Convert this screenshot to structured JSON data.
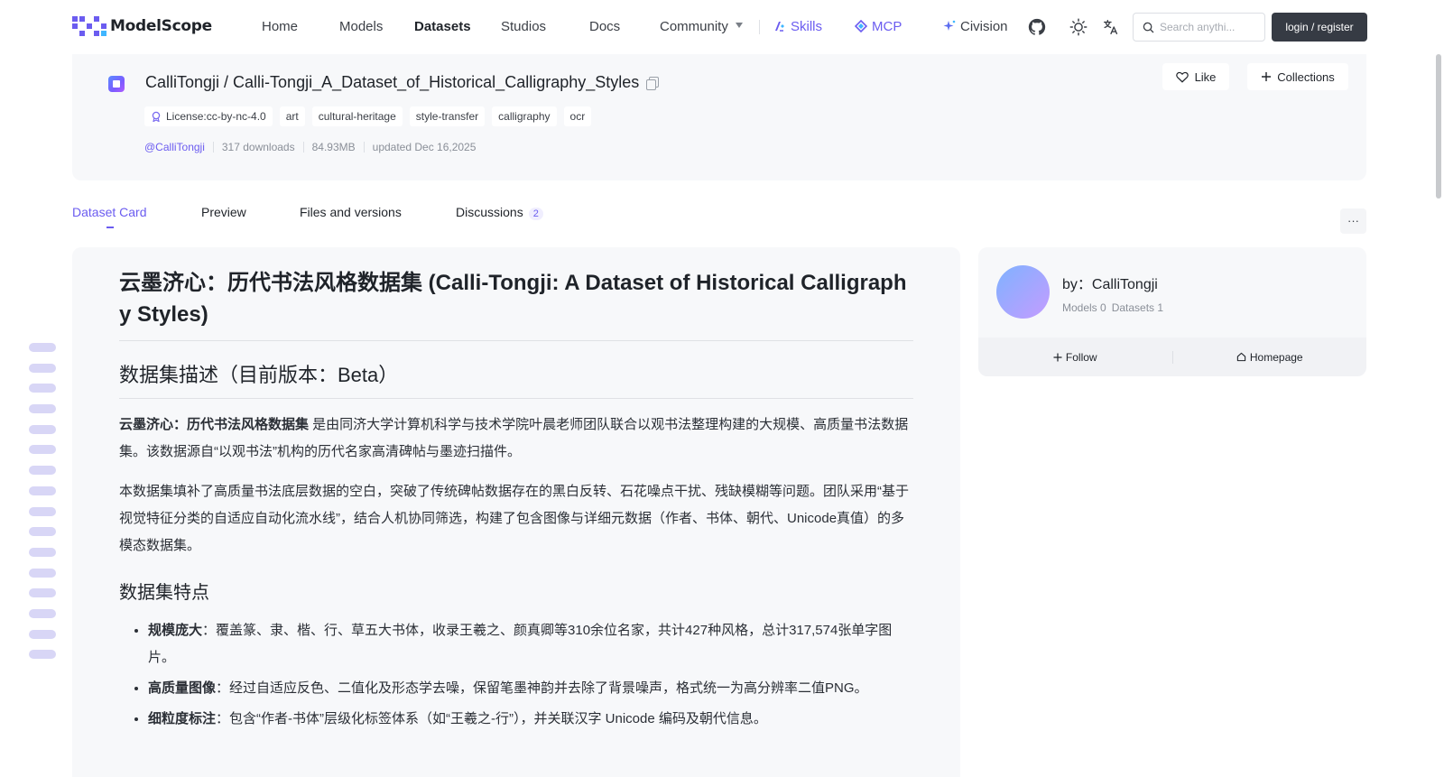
{
  "brand": {
    "name": "ModelScope"
  },
  "nav": {
    "home": "Home",
    "models": "Models",
    "datasets": "Datasets",
    "studios": "Studios",
    "docs": "Docs",
    "community": "Community",
    "skills": "Skills",
    "mcp": "MCP",
    "civision": "Civision"
  },
  "search": {
    "placeholder": "Search anythi..."
  },
  "auth": {
    "login_label": "login / register"
  },
  "dataset": {
    "title": "CalliTongji / Calli-Tongji_A_Dataset_of_Historical_Calligraphy_Styles",
    "license": "License:cc-by-nc-4.0",
    "tags": [
      "art",
      "cultural-heritage",
      "style-transfer",
      "calligraphy",
      "ocr"
    ],
    "owner": "@CalliTongji",
    "downloads": "317 downloads",
    "size": "84.93MB",
    "updated": "updated Dec 16,2025",
    "like_label": "Like",
    "collections_label": "Collections"
  },
  "tabs": {
    "card": "Dataset Card",
    "preview": "Preview",
    "files": "Files and versions",
    "discussions": "Discussions",
    "discussions_count": "2",
    "more": "···"
  },
  "card": {
    "h1": "云墨济心：历代书法风格数据集 (Calli-Tongji: A Dataset of Historical Calligraphy Styles)",
    "h2": "数据集描述（目前版本：Beta）",
    "p1_bold": "云墨济心：历代书法风格数据集",
    "p1_rest": " 是由同济大学计算机科学与技术学院叶晨老师团队联合以观书法整理构建的大规模、高质量书法数据集。该数据源自“以观书法”机构的历代名家高清碑帖与墨迹扫描件。",
    "p2": "本数据集填补了高质量书法底层数据的空白，突破了传统碑帖数据存在的黑白反转、石花噪点干扰、残缺模糊等问题。团队采用“基于视觉特征分类的自适应自动化流水线”，结合人机协同筛选，构建了包含图像与详细元数据（作者、书体、朝代、Unicode真值）的多模态数据集。",
    "h3": "数据集特点",
    "features": [
      {
        "title": "规模庞大",
        "text": "：覆盖篆、隶、楷、行、草五大书体，收录王羲之、颜真卿等310余位名家，共计427种风格，总计317,574张单字图片。"
      },
      {
        "title": "高质量图像",
        "text": "：经过自适应反色、二值化及形态学去噪，保留笔墨神韵并去除了背景噪声，格式统一为高分辨率二值PNG。"
      },
      {
        "title": "细粒度标注",
        "text": "：包含“作者-书体”层级化标签体系（如“王羲之-行”），并关联汉字 Unicode 编码及朝代信息。"
      }
    ]
  },
  "author": {
    "by": "by：CalliTongji",
    "models": "Models 0",
    "datasets": "Datasets 1",
    "follow": "Follow",
    "homepage": "Homepage"
  }
}
